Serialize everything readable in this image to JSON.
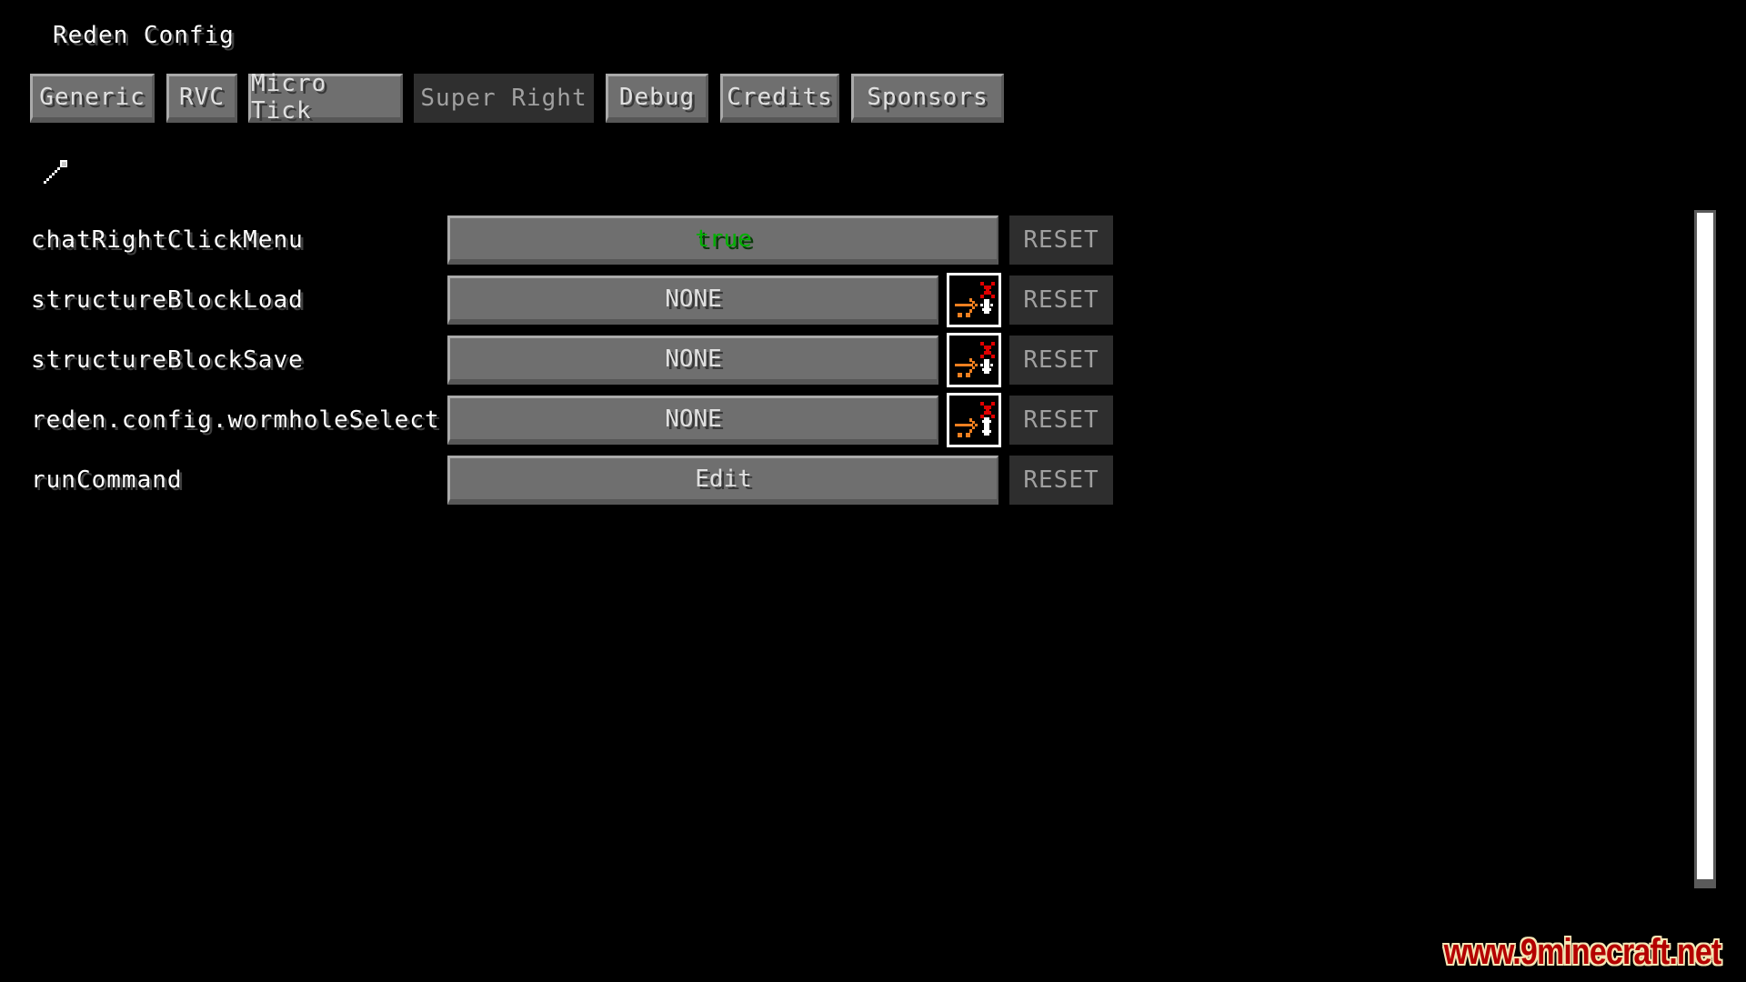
{
  "window": {
    "title": "Reden Config"
  },
  "tabs": [
    {
      "label": "Generic",
      "active": false
    },
    {
      "label": "RVC",
      "active": false
    },
    {
      "label": "Micro Tick",
      "active": false
    },
    {
      "label": "Super Right",
      "active": true
    },
    {
      "label": "Debug",
      "active": false
    },
    {
      "label": "Credits",
      "active": false
    },
    {
      "label": "Sponsors",
      "active": false
    }
  ],
  "search": {
    "icon": "search-icon"
  },
  "options": [
    {
      "name": "chatRightClickMenu",
      "value": "true",
      "value_color": "#00b000",
      "has_hotkey_settings": false,
      "reset_label": "RESET"
    },
    {
      "name": "structureBlockLoad",
      "value": "NONE",
      "has_hotkey_settings": true,
      "hotkey_icon": "hotkey-settings-down-icon",
      "reset_label": "RESET"
    },
    {
      "name": "structureBlockSave",
      "value": "NONE",
      "has_hotkey_settings": true,
      "hotkey_icon": "hotkey-settings-down-icon",
      "reset_label": "RESET"
    },
    {
      "name": "reden.config.wormholeSelect",
      "value": "NONE",
      "has_hotkey_settings": true,
      "hotkey_icon": "hotkey-settings-updown-icon",
      "reset_label": "RESET"
    },
    {
      "name": "runCommand",
      "value": "Edit",
      "has_hotkey_settings": false,
      "reset_label": "RESET"
    }
  ],
  "watermark": {
    "text": "www.9minecraft.net"
  },
  "colors": {
    "background": "#000000",
    "button": "#6f6f6f",
    "active_tab": "#2f2f2f",
    "reset": "#2e2e2e",
    "true_value": "#00b000",
    "hotkey_arrow": "#f08020",
    "hotkey_x": "#e00000"
  }
}
